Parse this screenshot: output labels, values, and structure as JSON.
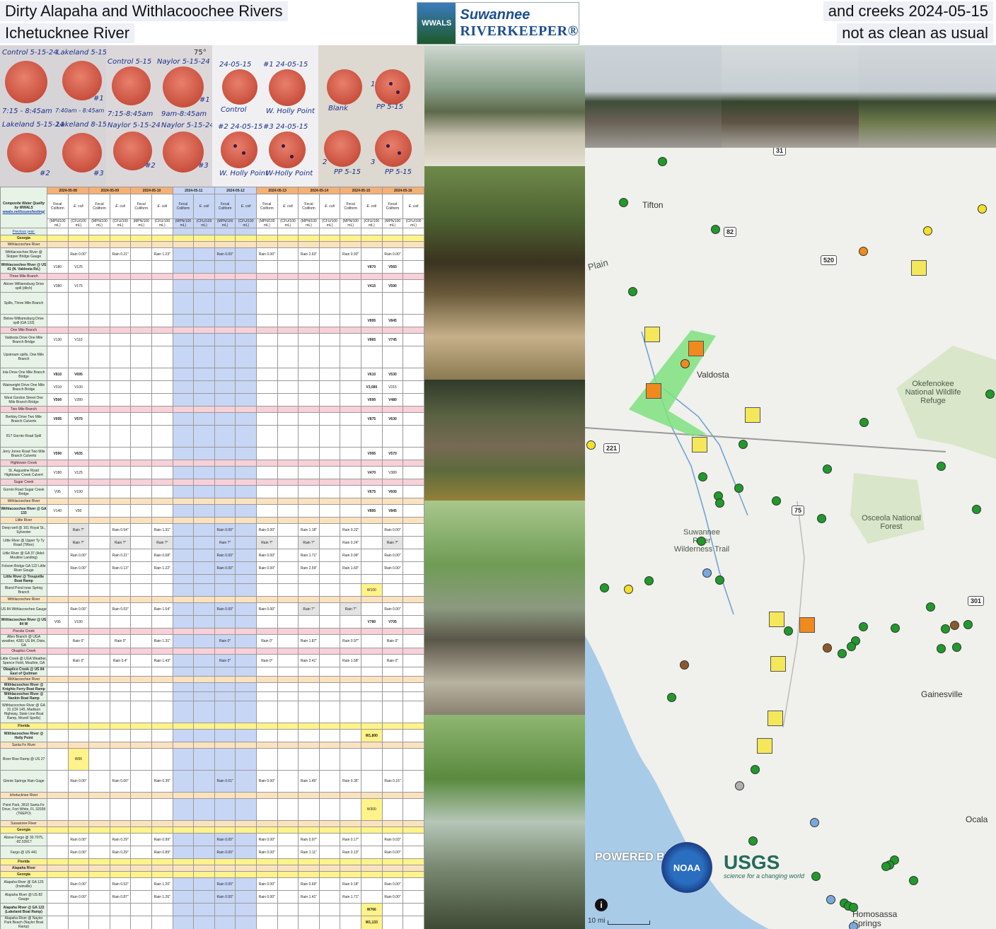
{
  "title": {
    "line1": "Dirty Alapaha and Withlacoochee Rivers",
    "line2": "Ichetucknee River",
    "line3": "and creeks 2024-05-15",
    "line4": "not as clean as usual"
  },
  "logo": {
    "badge": "WWALS",
    "word1": "Suwannee",
    "word2": "RIVERKEEPER®"
  },
  "plates": {
    "photo1": [
      "Control 5-15-24",
      "Lakeland 5-15",
      "7:15 - 8:45am",
      "7:40am - 8:45am",
      "Lakeland 5-15-24",
      "Lakeland 8-15-24",
      "#1",
      "#2",
      "#3"
    ],
    "photo2": [
      "Control 5-15",
      "Naylor 5-15-24",
      "7:15-8:45am",
      "9am-8:45am",
      "Naylor 5-15-24",
      "Naylor 5-15-24",
      "#1",
      "#2",
      "#3",
      "75°"
    ],
    "photo3": [
      "24-05-15",
      "#1 24-05-15",
      "Control",
      "W. Holly Point",
      "#2 24-05-15",
      "#3 24-05-15",
      "W. Holly Point",
      "W-Holly Point"
    ],
    "photo4": [
      "Blank",
      "PP 5-15",
      "PP 5-15",
      "PP 5-15",
      "1",
      "2",
      "3"
    ]
  },
  "table": {
    "corner": "Composite Water Quality by WWALS",
    "corner_link": "wwals.net/issues/testing/",
    "prev_year": "Previous year:",
    "dates": [
      "2024-05-08",
      "2024-05-09",
      "2024-05-10",
      "2024-05-11",
      "2024-05-12",
      "2024-05-13",
      "2024-05-14",
      "2024-05-15",
      "2024-05-16"
    ],
    "sub": [
      "Fecal Coliform",
      "E. coli"
    ],
    "units": [
      "(MPN/100 mL)",
      "(CFU/100 mL)"
    ],
    "rows": [
      {
        "loc": "Georgia",
        "cls": "yellow",
        "bold": true,
        "cells": []
      },
      {
        "loc": "Withlacoochee River",
        "cls": "peach",
        "cells": []
      },
      {
        "loc": "Withlacoochee River @ Skipper Bridge Gauge",
        "cells": [
          "",
          "Rain 0.00\"",
          "",
          "Rain 0.21\"",
          "",
          "Rain 1.23\"",
          "",
          "",
          "Rain 0.00\"",
          "",
          "Rain 0.00\"",
          "",
          "Rain 2.63\"",
          "",
          "Rain 0.93\"",
          "",
          "Rain 0.00\"",
          "",
          "Rain 0.00\""
        ]
      },
      {
        "loc": "Withlacoochee River @ US 41 (N. Valdosta Rd.)",
        "bold": true,
        "cells": [
          "V180",
          "V125",
          "",
          "",
          "",
          "",
          "",
          "",
          "",
          "",
          "",
          "",
          "",
          "",
          "",
          "V870",
          "V560",
          "",
          ""
        ]
      },
      {
        "loc": "Three Mile Branch",
        "cls": "pink",
        "cells": []
      },
      {
        "loc": "Above Williamsburg Drive spill (ditch)",
        "cells": [
          "V380",
          "V175",
          "",
          "",
          "",
          "",
          "",
          "",
          "",
          "",
          "",
          "",
          "",
          "",
          "",
          "V415",
          "V590",
          "",
          ""
        ]
      },
      {
        "loc": "Spills, Three Mile Branch",
        "tall": true,
        "cells": []
      },
      {
        "loc": "Below Williamsburg Drive spill (GA 133)",
        "cells": [
          "",
          "",
          "",
          "",
          "",
          "",
          "",
          "",
          "",
          "",
          "",
          "",
          "",
          "",
          "",
          "V895",
          "V845",
          "",
          ""
        ]
      },
      {
        "loc": "One Mile Branch",
        "cls": "pink",
        "cells": []
      },
      {
        "loc": "Valdosta Drive One Mile Branch Bridge",
        "cells": [
          "V130",
          "V110",
          "",
          "",
          "",
          "",
          "",
          "",
          "",
          "",
          "",
          "",
          "",
          "",
          "",
          "V865",
          "V745",
          "",
          ""
        ]
      },
      {
        "loc": "Upstream spills, One Mile Branch",
        "tall": true,
        "cells": []
      },
      {
        "loc": "Iola Drive One Mile Branch Bridge",
        "cells": [
          "V810",
          "V695",
          "",
          "",
          "",
          "",
          "",
          "",
          "",
          "",
          "",
          "",
          "",
          "",
          "",
          "V610",
          "V530",
          "",
          ""
        ]
      },
      {
        "loc": "Wainwright Drive One Mile Branch Bridge",
        "cells": [
          "V310",
          "V100",
          "",
          "",
          "",
          "",
          "",
          "",
          "",
          "",
          "",
          "",
          "",
          "",
          "",
          "V3,080",
          "V315",
          "",
          ""
        ]
      },
      {
        "loc": "West Gordon Street One Mile Branch Bridge",
        "cells": [
          "V500",
          "V280",
          "",
          "",
          "",
          "",
          "",
          "",
          "",
          "",
          "",
          "",
          "",
          "",
          "",
          "V690",
          "V480",
          "",
          ""
        ]
      },
      {
        "loc": "Two Mile Branch",
        "cls": "pink",
        "cells": []
      },
      {
        "loc": "Berkley Drive Two Mile Branch Culverts",
        "cells": [
          "V695",
          "V570",
          "",
          "",
          "",
          "",
          "",
          "",
          "",
          "",
          "",
          "",
          "",
          "",
          "",
          "V875",
          "V630",
          "",
          ""
        ]
      },
      {
        "loc": "817 Gornto Road Spill",
        "tall": true,
        "cells": []
      },
      {
        "loc": "Jerry Jones Road Two Mile Branch Culverts",
        "cells": [
          "V590",
          "V635",
          "",
          "",
          "",
          "",
          "",
          "",
          "",
          "",
          "",
          "",
          "",
          "",
          "",
          "V995",
          "V570",
          "",
          ""
        ]
      },
      {
        "loc": "Hightower Creek",
        "cls": "pink",
        "cells": []
      },
      {
        "loc": "St. Augustine Road Hightower Creek Culvert",
        "cells": [
          "V180",
          "V125",
          "",
          "",
          "",
          "",
          "",
          "",
          "",
          "",
          "",
          "",
          "",
          "",
          "",
          "V470",
          "V380",
          "",
          ""
        ]
      },
      {
        "loc": "Sugar Creek",
        "cls": "pink",
        "cells": []
      },
      {
        "loc": "Gornto Road Sugar Creek Bridge",
        "cells": [
          "V95",
          "V190",
          "",
          "",
          "",
          "",
          "",
          "",
          "",
          "",
          "",
          "",
          "",
          "",
          "",
          "V675",
          "V600",
          "",
          ""
        ]
      },
      {
        "loc": "Withlacoochee River",
        "cls": "peach",
        "cells": []
      },
      {
        "loc": "Withlacoochee River @ GA 133",
        "bold": true,
        "cells": [
          "V140",
          "V90",
          "",
          "",
          "",
          "",
          "",
          "",
          "",
          "",
          "",
          "",
          "",
          "",
          "",
          "V895",
          "V845",
          "",
          ""
        ]
      },
      {
        "loc": "Little River",
        "cls": "peach",
        "cells": []
      },
      {
        "loc": "Deep well @ 161 Royal St., Sylvester",
        "cells": [
          "",
          "Rain ?\"",
          "",
          "Rain 0.54\"",
          "",
          "Rain 1.31\"",
          "",
          "",
          "Rain 0.00\"",
          "",
          "Rain 0.00\"",
          "",
          "Rain 1.18\"",
          "",
          "Rain 0.22\"",
          "",
          "Rain 0.00\"",
          "",
          "Rain 0.00\""
        ]
      },
      {
        "loc": "Little River @ Upper Ty Ty Road (Tifton)",
        "cells": [
          "",
          "Rain ?\"",
          "",
          "Rain ?\"",
          "",
          "Rain ?\"",
          "",
          "",
          "Rain ?\"",
          "",
          "Rain ?\"",
          "",
          "Rain ?\"",
          "",
          "Rain 0.24\"",
          "",
          "Rain ?\"",
          "",
          "Rain 0.00\""
        ]
      },
      {
        "loc": "Little River @ GA 37 (Adel-Moultrie Landing)",
        "cells": [
          "",
          "Rain 0.00\"",
          "",
          "Rain 0.21\"",
          "",
          "Rain 0.68\"",
          "",
          "",
          "Rain 0.00\"",
          "",
          "Rain 0.00\"",
          "",
          "Rain 1.71\"",
          "",
          "Rain 0.99\"",
          "",
          "Rain 0.00\"",
          "",
          "Rain 0.00\""
        ]
      },
      {
        "loc": "Folsom Bridge GA 122 Little River Gauge",
        "cells": [
          "",
          "Rain 0.00\"",
          "",
          "Rain 0.13\"",
          "",
          "Rain 1.22\"",
          "",
          "",
          "Rain 0.00\"",
          "",
          "Rain 0.00\"",
          "",
          "Rain 2.59\"",
          "",
          "Rain 1.60\"",
          "",
          "Rain 0.00\"",
          "",
          "Rain 0.00\""
        ]
      },
      {
        "loc": "Little River @ Troupville Boat Ramp",
        "bold": true,
        "cells": []
      },
      {
        "loc": "Bland Pond near Spring Branch",
        "cells": [
          "",
          "",
          "",
          "",
          "",
          "",
          "",
          "",
          "",
          "",
          "",
          "",
          "",
          "",
          "",
          "W100",
          "",
          "",
          ""
        ]
      },
      {
        "loc": "Withlacoochee River",
        "cls": "peach",
        "cells": []
      },
      {
        "loc": "US 84 Withlacoochee Gauge",
        "cells": [
          "",
          "Rain 0.00\"",
          "",
          "Rain 0.03\"",
          "",
          "Rain 1.54\"",
          "",
          "",
          "Rain 0.00\"",
          "",
          "Rain 0.00\"",
          "",
          "Rain ?\"",
          "",
          "Rain ?\"",
          "",
          "Rain 0.00\"",
          "",
          "Rain 0.00\""
        ]
      },
      {
        "loc": "Withlacoochee River @ US 84 W",
        "bold": true,
        "cells": [
          "V95",
          "V190",
          "",
          "",
          "",
          "",
          "",
          "",
          "",
          "",
          "",
          "",
          "",
          "",
          "",
          "V780",
          "V705",
          "",
          ""
        ]
      },
      {
        "loc": "Piscola Creek",
        "cls": "pink",
        "cells": []
      },
      {
        "loc": "Allen Branch @ UGA weather, 4281 US 84, Dixie, GA",
        "cells": [
          "",
          "Rain 0\"",
          "",
          "Rain 0\"",
          "",
          "Rain 1.31\"",
          "",
          "",
          "Rain 0\"",
          "",
          "Rain 0\"",
          "",
          "Rain 1.87\"",
          "",
          "Rain 0.97\"",
          "",
          "Rain 0\"",
          "",
          "Rain 0\""
        ]
      },
      {
        "loc": "Okapilco Creek",
        "cls": "pink",
        "cells": []
      },
      {
        "loc": "Little Creek @ UGA Weather, Spence Field, Moultrie, GA",
        "cells": [
          "",
          "Rain 0\"",
          "",
          "Rain 0.4\"",
          "",
          "Rain 1.43\"",
          "",
          "",
          "Rain 0\"",
          "",
          "Rain 0\"",
          "",
          "Rain 2.41\"",
          "",
          "Rain 1.58\"",
          "",
          "Rain 0\"",
          "",
          "Rain 0\""
        ]
      },
      {
        "loc": "Okapilco Creek @ US 84 East of Quitman",
        "bold": true,
        "cells": []
      },
      {
        "loc": "Withlacoochee River",
        "cls": "peach",
        "cells": []
      },
      {
        "loc": "Withlacoochee River @ Knights Ferry Boat Ramp",
        "bold": true,
        "cells": []
      },
      {
        "loc": "Withlacoochee River @ Nankin Boat Ramp",
        "bold": true,
        "cells": []
      },
      {
        "loc": "Withlacoochee River @ GA 31 (CR 145, Madison Highway, State Line Boat Ramp, Mozell Spells)",
        "tall": true,
        "cells": []
      },
      {
        "loc": "Florida",
        "cls": "yellow",
        "bold": true,
        "cells": []
      },
      {
        "loc": "Withlacoochee River @ Holly Point",
        "bold": true,
        "cells": [
          "",
          "",
          "",
          "",
          "",
          "",
          "",
          "",
          "",
          "",
          "",
          "",
          "",
          "",
          "",
          "W1,800",
          "",
          "",
          ""
        ]
      },
      {
        "loc": "Santa Fe River",
        "cls": "peach",
        "cells": []
      },
      {
        "loc": "River Rise Ramp @ US 27",
        "tall": true,
        "cells": [
          "",
          "W66",
          "",
          "",
          "",
          "",
          "",
          "",
          "",
          "",
          "",
          "",
          "",
          "",
          "",
          "",
          "",
          "",
          ""
        ]
      },
      {
        "loc": "Ginnie Springs Rain Gage",
        "tall": true,
        "cells": [
          "",
          "Rain 0.00\"",
          "",
          "Rain 0.00\"",
          "",
          "Rain 0.35\"",
          "",
          "",
          "Rain 0.01\"",
          "",
          "Rain 0.00\"",
          "",
          "Rain 1.45\"",
          "",
          "Rain 0.35\"",
          "",
          "Rain 0.15\"",
          "",
          "Rain 0.00\""
        ]
      },
      {
        "loc": "Ichetucknee River",
        "cls": "peach",
        "cells": []
      },
      {
        "loc": "Point Park, 2810 Santa Fe Drive, Fort White, FL 32038 (TREPO)",
        "tall": true,
        "cells": [
          "",
          "",
          "",
          "",
          "",
          "",
          "",
          "",
          "",
          "",
          "",
          "",
          "",
          "",
          "",
          "W300",
          "",
          "",
          ""
        ]
      },
      {
        "loc": "Suwannee River",
        "cls": "peach",
        "cells": []
      },
      {
        "loc": "Georgia",
        "cls": "yellow",
        "bold": true,
        "cells": []
      },
      {
        "loc": "Above Fargo @ 30.7075, -82.53917",
        "cells": [
          "",
          "Rain 0.00\"",
          "",
          "Rain 0.29\"",
          "",
          "Rain 0.99\"",
          "",
          "",
          "Rain 0.00\"",
          "",
          "Rain 0.00\"",
          "",
          "Rain 0.97\"",
          "",
          "Rain 0.17\"",
          "",
          "Rain 0.03\"",
          "",
          "Rain 0.00\""
        ]
      },
      {
        "loc": "Fargo @ US 441",
        "cells": [
          "",
          "Rain 0.00\"",
          "",
          "Rain 0.29\"",
          "",
          "Rain 0.89\"",
          "",
          "",
          "Rain 0.00\"",
          "",
          "Rain 0.00\"",
          "",
          "Rain 1.11\"",
          "",
          "Rain 0.13\"",
          "",
          "Rain 0.00\"",
          "",
          "Rain 0.00\""
        ]
      },
      {
        "loc": "Florida",
        "cls": "yellow",
        "bold": true,
        "cells": []
      },
      {
        "loc": "Alapaha River",
        "cls": "peach",
        "bold": true,
        "cells": []
      },
      {
        "loc": "Georgia",
        "cls": "yellow",
        "bold": true,
        "cells": []
      },
      {
        "loc": "Alapaha River @ GA 125 (Irwinville)",
        "cells": [
          "",
          "Rain 0.00\"",
          "",
          "Rain 0.53\"",
          "",
          "Rain 1.20\"",
          "",
          "",
          "Rain 0.00\"",
          "",
          "Rain 0.00\"",
          "",
          "Rain 0.69\"",
          "",
          "Rain 0.18\"",
          "",
          "Rain 0.00\"",
          "",
          "Rain 0.00\""
        ]
      },
      {
        "loc": "Alapaha River @ US 82 Gauge",
        "cells": [
          "",
          "Rain 0.00\"",
          "",
          "Rain 0.87\"",
          "",
          "Rain 1.26\"",
          "",
          "",
          "Rain 0.00\"",
          "",
          "Rain 0.00\"",
          "",
          "Rain 1.41\"",
          "",
          "Rain 1.71\"",
          "",
          "Rain 0.00\"",
          "",
          "Rain 0.00\""
        ]
      },
      {
        "loc": "Alapaha River @ GA 122 (Lakeland Boat Ramp)",
        "bold": true,
        "cells": [
          "",
          "",
          "",
          "",
          "",
          "",
          "",
          "",
          "",
          "",
          "",
          "",
          "",
          "",
          "",
          "W766",
          "",
          "",
          ""
        ]
      },
      {
        "loc": "Alapaha River @ Naylor Park Beach (Naylor Boat Ramp)",
        "cells": [
          "",
          "",
          "",
          "",
          "",
          "",
          "",
          "",
          "",
          "",
          "",
          "",
          "",
          "",
          "",
          "W1,133",
          "",
          "",
          ""
        ]
      },
      {
        "loc": "Alapaha River",
        "cls": "peach",
        "bold": true,
        "cells": []
      },
      {
        "loc": "Alapaha River @ GA 94 (Statenville Boat Ramp)",
        "cells": [
          "",
          "Rain 0.00\"",
          "",
          "Rain 0.61\"",
          "",
          "Rain 0.85\"",
          "",
          "",
          "Rain 0.00\"",
          "",
          "Rain 0.00\"",
          "",
          "Rain 1.41\"",
          "",
          "Rain 0.36\"",
          "",
          "Rain 0.00\"",
          "",
          "Rain 0.00\""
        ]
      },
      {
        "loc": "Florida",
        "cls": "yellow",
        "bold": true,
        "cells": []
      }
    ]
  },
  "map": {
    "cities": [
      "Tifton",
      "Valdosta",
      "Gainesville",
      "Ocala",
      "Homosassa Springs"
    ],
    "parks": [
      "Okefenokee National Wildlife Refuge",
      "Osceola National Forest",
      "Suwannee River Wilderness Trail",
      "Plain"
    ],
    "shields": [
      "82",
      "520",
      "221",
      "75",
      "301",
      "31"
    ],
    "attribution": [
      "POWERED BY esri",
      "NOAA",
      "USGS",
      "science for a changing world"
    ],
    "scale": "10 mi",
    "info_icon": "i"
  },
  "colors": {
    "green": "#1f9a2b",
    "yellow": "#f4e02a",
    "orange": "#f08a1e",
    "brown": "#8b5a2b",
    "blue": "#79a8dc",
    "gray": "#b0b0b0",
    "polygon": "#7fe27f"
  }
}
